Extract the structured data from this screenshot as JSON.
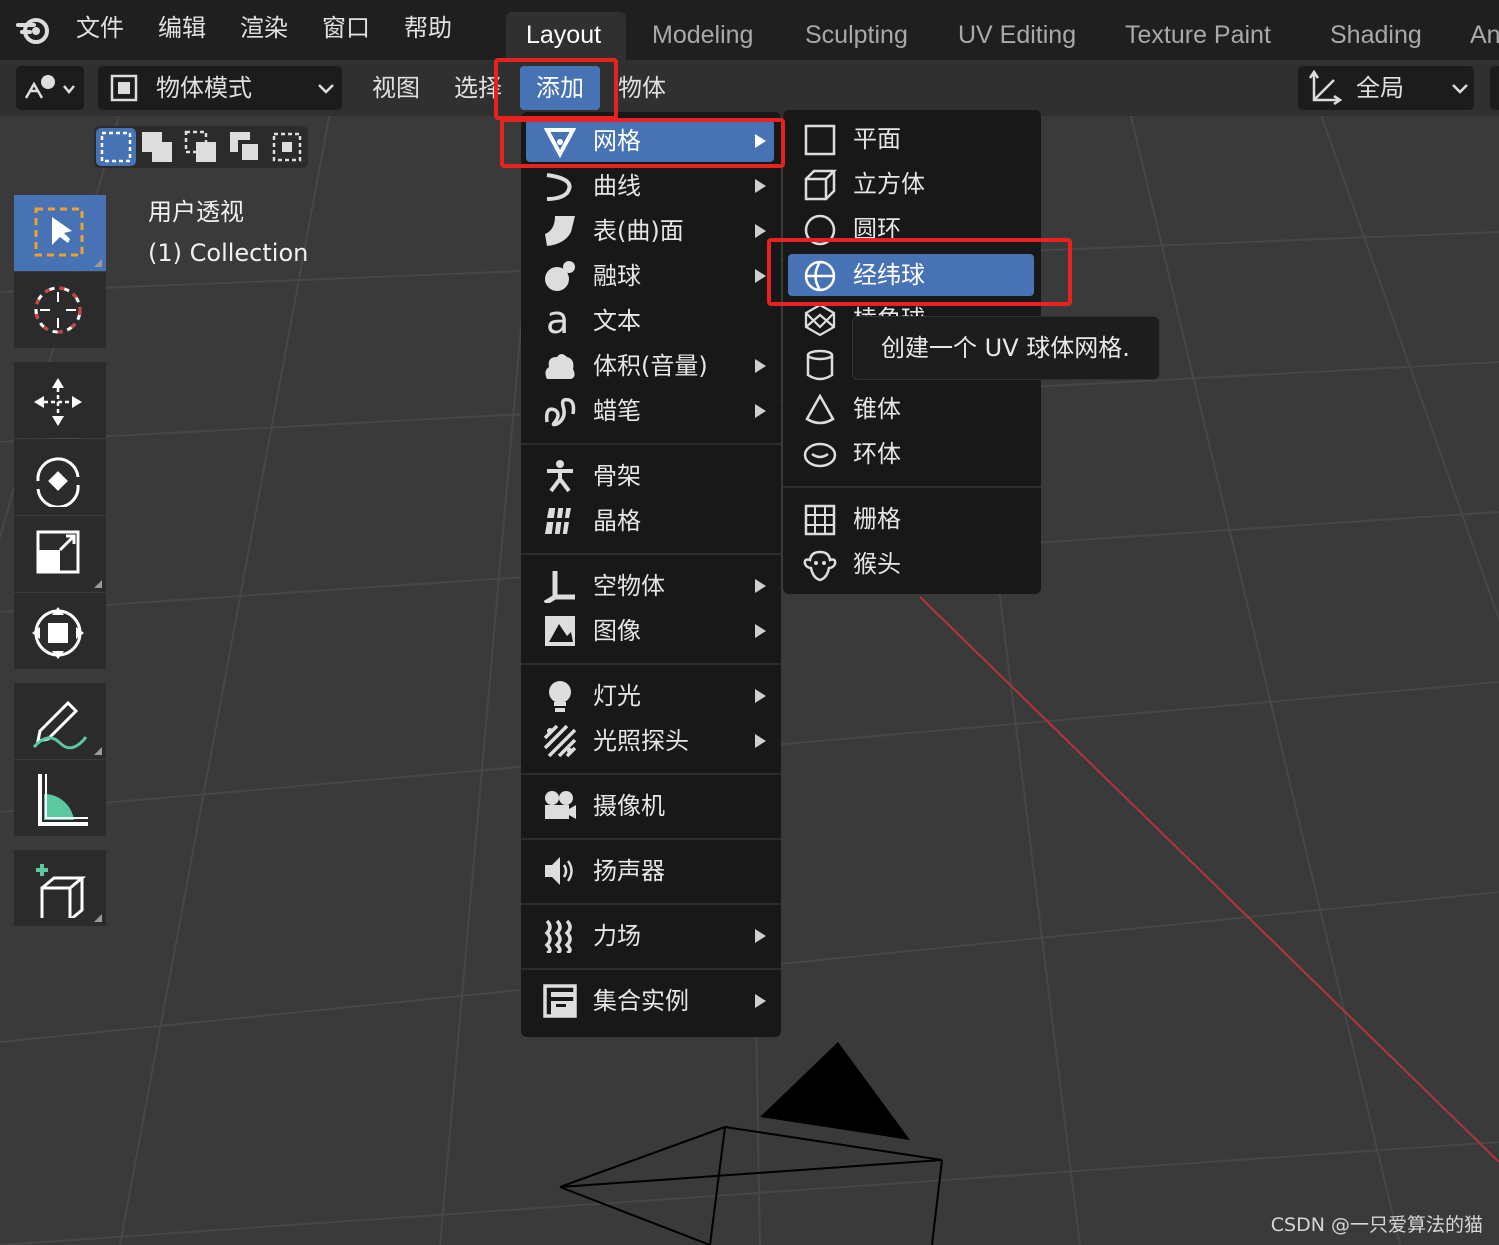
{
  "topbar": {
    "menus": [
      "文件",
      "编辑",
      "渲染",
      "窗口",
      "帮助"
    ],
    "workspaces": [
      "Layout",
      "Modeling",
      "Sculpting",
      "UV Editing",
      "Texture Paint",
      "Shading",
      "An"
    ],
    "active_workspace": "Layout"
  },
  "header": {
    "mode": "物体模式",
    "view_menu": "视图",
    "select_menu": "选择",
    "add_menu": "添加",
    "object_menu": "物体",
    "orientation": "全局"
  },
  "viewport": {
    "perspective_label": "用户透视",
    "collection_label": "(1) Collection"
  },
  "add_menu": {
    "items": [
      {
        "label": "网格",
        "icon": "mesh-icon",
        "submenu": true,
        "highlighted": true
      },
      {
        "label": "曲线",
        "icon": "curve-icon",
        "submenu": true
      },
      {
        "label": "表(曲)面",
        "icon": "surface-icon",
        "submenu": true
      },
      {
        "label": "融球",
        "icon": "metaball-icon",
        "submenu": true
      },
      {
        "label": "文本",
        "icon": "text-icon",
        "submenu": false
      },
      {
        "label": "体积(音量)",
        "icon": "volume-icon",
        "submenu": true
      },
      {
        "label": "蜡笔",
        "icon": "grease-pencil-icon",
        "submenu": true
      },
      {
        "label": "骨架",
        "icon": "armature-icon",
        "submenu": false
      },
      {
        "label": "晶格",
        "icon": "lattice-icon",
        "submenu": false
      },
      {
        "label": "空物体",
        "icon": "empty-icon",
        "submenu": true
      },
      {
        "label": "图像",
        "icon": "image-icon",
        "submenu": true
      },
      {
        "label": "灯光",
        "icon": "light-icon",
        "submenu": true
      },
      {
        "label": "光照探头",
        "icon": "light-probe-icon",
        "submenu": true
      },
      {
        "label": "摄像机",
        "icon": "camera-icon",
        "submenu": false
      },
      {
        "label": "扬声器",
        "icon": "speaker-icon",
        "submenu": false
      },
      {
        "label": "力场",
        "icon": "force-field-icon",
        "submenu": true
      },
      {
        "label": "集合实例",
        "icon": "collection-instance-icon",
        "submenu": true
      }
    ]
  },
  "mesh_menu": {
    "items": [
      {
        "label": "平面",
        "icon": "plane-icon"
      },
      {
        "label": "立方体",
        "icon": "cube-icon"
      },
      {
        "label": "圆环",
        "icon": "circle-icon"
      },
      {
        "label": "经纬球",
        "icon": "uv-sphere-icon",
        "highlighted": true
      },
      {
        "label": "棱角球",
        "icon": "ico-sphere-icon"
      },
      {
        "label": "",
        "icon": "cylinder-icon"
      },
      {
        "label": "锥体",
        "icon": "cone-icon"
      },
      {
        "label": "环体",
        "icon": "torus-icon"
      },
      {
        "label": "栅格",
        "icon": "grid-icon"
      },
      {
        "label": "猴头",
        "icon": "monkey-icon"
      }
    ],
    "tooltip": "创建一个 UV 球体网格."
  },
  "watermark": "CSDN @一只爱算法的猫",
  "colors": {
    "highlight": "#4772b3",
    "annotation": "#e8231f",
    "menu_bg": "#181818",
    "viewport_bg": "#3a3a3a"
  }
}
